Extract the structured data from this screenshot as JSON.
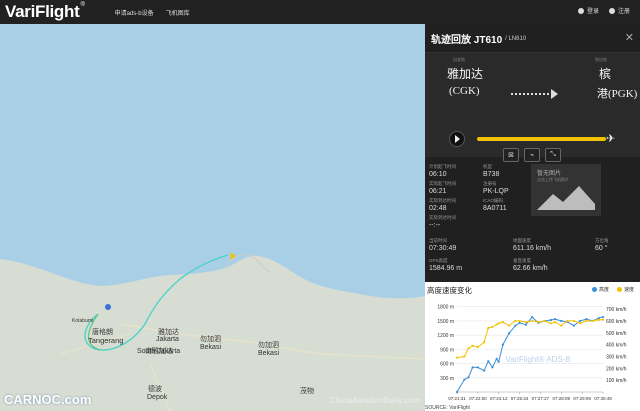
{
  "header": {
    "logo": "VariFlight",
    "logo_mark": "®",
    "nav": [
      "申请ads-b设备",
      "飞机图库"
    ],
    "login": "登录",
    "register": "注册"
  },
  "map": {
    "labels": [
      {
        "text": "唐格朗",
        "cn": true
      },
      {
        "text": "Tangerang",
        "cn": false
      },
      {
        "text": "雅加达",
        "cn": true
      },
      {
        "text": "Jakarta",
        "cn": false
      },
      {
        "text": "南雅加达",
        "cn": true
      },
      {
        "text": "South Jakarta",
        "cn": false
      },
      {
        "text": "勿加泗",
        "cn": true
      },
      {
        "text": "Bekasi",
        "cn": false
      },
      {
        "text": "勿加泗",
        "cn": true
      },
      {
        "text": "Bekasi",
        "cn": false
      },
      {
        "text": "德波",
        "cn": true
      },
      {
        "text": "Depok",
        "cn": false
      },
      {
        "text": "茂物",
        "cn": true
      },
      {
        "text": "Kotabumi",
        "cn": false
      }
    ],
    "watermark_left": "CARNOC.com",
    "watermark_right": "ChinaAviationDaily.com"
  },
  "panel": {
    "title": "轨迹回放 JT610",
    "ln": "/ LN610",
    "close": "✕",
    "dep_label": "出发地",
    "arr_label": "到达地",
    "dep_city": "雅加达",
    "dep_code": "(CGK)",
    "arr_city_top": "槟",
    "arr_city_bottom": "港(PGK)",
    "plan_dep_label": "计划起飞时间",
    "plan_dep": "06:10",
    "act_dep_label": "实际起飞时间",
    "act_dep": "06:21",
    "plan_arr_label": "实际到达时间",
    "plan_arr": "02:48",
    "est_arr_label": "实际到达时间",
    "est_arr": "--:--",
    "model_label": "机型",
    "model": "B738",
    "reg_label": "注册号",
    "reg": "PK-LQP",
    "icao_label": "ICAO编码",
    "icao": "8A0711",
    "no_image": "暂无图片",
    "no_image_sub": "点击上传飞机照片",
    "cur_time_label": "当前时间",
    "cur_time": "07:30:49",
    "gps_alt_label": "GPS高度",
    "gps_alt": "1584.96 m",
    "ground_speed_label": "地面速度",
    "ground_speed": "611.16 km/h",
    "vert_speed_label": "垂直速度",
    "vert_speed": "62.66 km/h",
    "heading_label": "方位角",
    "heading": "60 °",
    "chart_title": "高度速度变化",
    "legend_alt": "高度",
    "legend_speed": "速度",
    "source": "SOURCE: VariFlight",
    "chart_watermark": "VariFlight® ADS-B"
  },
  "colors": {
    "altitude": "#3b8fd9",
    "speed": "#f2c200",
    "track": "#4fd1c5",
    "land": "#d7ddd4",
    "water": "#a9cfe6"
  },
  "chart_data": {
    "type": "line",
    "title": "高度速度变化",
    "x": [
      "07:21:31",
      "07:22:50",
      "07:24:12",
      "07:25:34",
      "07:27:27",
      "07:28:09",
      "07:29:09",
      "07:30:49"
    ],
    "series": [
      {
        "name": "高度",
        "axis": "left",
        "unit": "m",
        "points": [
          [
            0,
            0
          ],
          [
            0.35,
            260
          ],
          [
            0.55,
            310
          ],
          [
            0.75,
            520
          ],
          [
            1,
            520
          ],
          [
            1.3,
            450
          ],
          [
            1.5,
            650
          ],
          [
            1.7,
            520
          ],
          [
            1.9,
            700
          ],
          [
            2,
            640
          ],
          [
            2.2,
            1000
          ],
          [
            2.5,
            1240
          ],
          [
            2.8,
            1400
          ],
          [
            3,
            1460
          ],
          [
            3.3,
            1420
          ],
          [
            3.6,
            1580
          ],
          [
            3.9,
            1460
          ],
          [
            4.2,
            1500
          ],
          [
            4.5,
            1520
          ],
          [
            4.7,
            1540
          ],
          [
            5,
            1500
          ],
          [
            5.3,
            1480
          ],
          [
            5.6,
            1400
          ],
          [
            5.9,
            1500
          ],
          [
            6.2,
            1540
          ],
          [
            6.5,
            1500
          ],
          [
            6.8,
            1560
          ],
          [
            7,
            1585
          ]
        ]
      },
      {
        "name": "速度",
        "axis": "right",
        "unit": "km/h",
        "points": [
          [
            0,
            290
          ],
          [
            0.35,
            300
          ],
          [
            0.55,
            370
          ],
          [
            0.75,
            390
          ],
          [
            1,
            380
          ],
          [
            1.3,
            420
          ],
          [
            1.5,
            540
          ],
          [
            1.7,
            550
          ],
          [
            1.9,
            570
          ],
          [
            2,
            580
          ],
          [
            2.2,
            590
          ],
          [
            2.5,
            560
          ],
          [
            2.8,
            600
          ],
          [
            3,
            600
          ],
          [
            3.3,
            590
          ],
          [
            3.6,
            600
          ],
          [
            3.9,
            590
          ],
          [
            4.2,
            600
          ],
          [
            4.5,
            580
          ],
          [
            4.7,
            590
          ],
          [
            5,
            560
          ],
          [
            5.3,
            600
          ],
          [
            5.6,
            600
          ],
          [
            5.9,
            580
          ],
          [
            6.2,
            600
          ],
          [
            6.5,
            600
          ],
          [
            6.8,
            610
          ],
          [
            7,
            611
          ]
        ]
      }
    ],
    "y_left": {
      "ticks": [
        300,
        600,
        900,
        1200,
        1500,
        1800
      ],
      "labels": [
        "300 m",
        "600 m",
        "900 m",
        "1200 m",
        "1500 m",
        "1800 m"
      ],
      "ylim": [
        0,
        1900
      ]
    },
    "y_right": {
      "ticks": [
        100,
        200,
        300,
        400,
        500,
        600,
        700
      ],
      "labels": [
        "100 km/h",
        "200 km/h",
        "300 km/h",
        "400 km/h",
        "500 km/h",
        "600 km/h",
        "700 km/h"
      ],
      "ylim": [
        0,
        760
      ]
    },
    "grid": true,
    "legend": "top-right"
  }
}
